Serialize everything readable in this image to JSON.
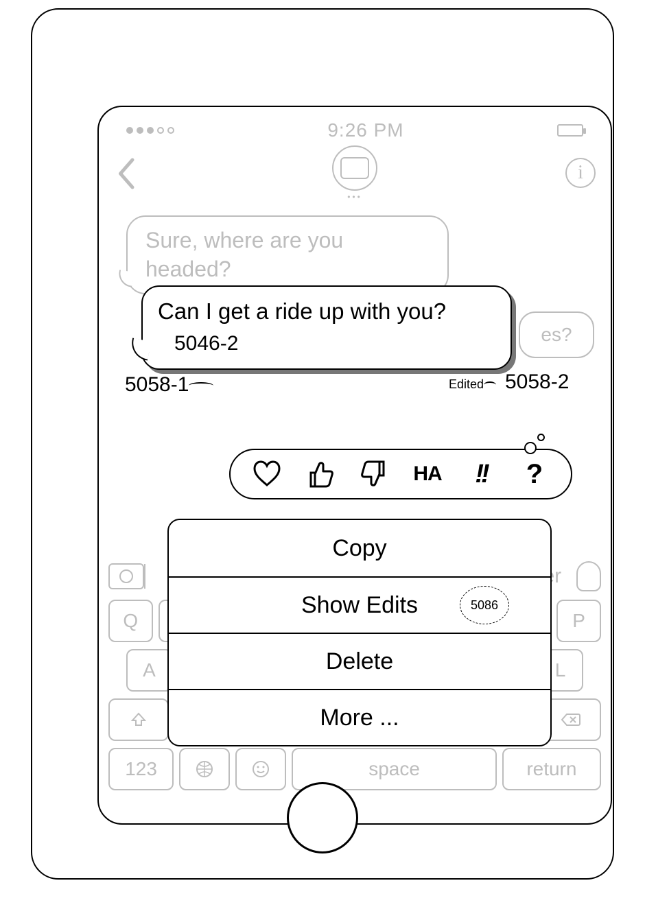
{
  "status": {
    "time": "9:26 PM"
  },
  "header": {
    "avatar_label": "•••"
  },
  "bg_messages": {
    "incoming1": "Sure, where are you headed?",
    "outgoing_fragment": "es?"
  },
  "edited_message": {
    "text": "Can I get a ride up with you?",
    "ref_inline": "5046-2",
    "edited_label": "Edited",
    "ref_left": "5058-1",
    "ref_right": "5058-2"
  },
  "reactions": {
    "ha_label": "HA",
    "excl_label": "!!",
    "q_label": "?"
  },
  "menu": {
    "items": [
      {
        "label": "Copy"
      },
      {
        "label": "Show Edits",
        "badge": "5086"
      },
      {
        "label": "Delete"
      },
      {
        "label": "More ..."
      }
    ]
  },
  "keyboard": {
    "suggest_later": "later",
    "row1": [
      "Q",
      "",
      "",
      "",
      "",
      "",
      "",
      "",
      "",
      "P"
    ],
    "row2": [
      "A",
      "",
      "",
      "",
      "",
      "",
      "",
      "",
      "L"
    ],
    "row4_123": "123",
    "row4_space": "space",
    "row4_return": "return"
  }
}
